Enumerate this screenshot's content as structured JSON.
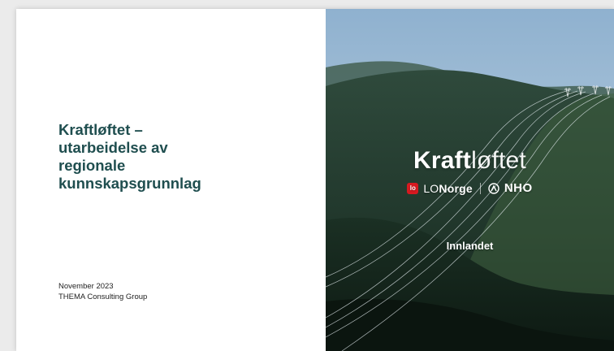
{
  "slide": {
    "title_lines": [
      "Kraftløftet –",
      "utarbeidelse av",
      "regionale",
      "kunnskapsgrunnlag"
    ],
    "date": "November 2023",
    "author": "THEMA Consulting Group"
  },
  "brand": {
    "name_bold": "Kraft",
    "name_light": "løftet",
    "lo_icon_text": "lo",
    "lo_prefix": "LO",
    "lo_name": "Norge",
    "nho_name": "NHO"
  },
  "region": "Innlandet",
  "colors": {
    "title": "#1f4e4f",
    "lo_red": "#d71920",
    "sky": "#b9cfe0",
    "forest": "#1f3a2d"
  },
  "icons": [
    "lo-logo-icon",
    "nho-logo-icon",
    "power-line-pylon-icon"
  ]
}
